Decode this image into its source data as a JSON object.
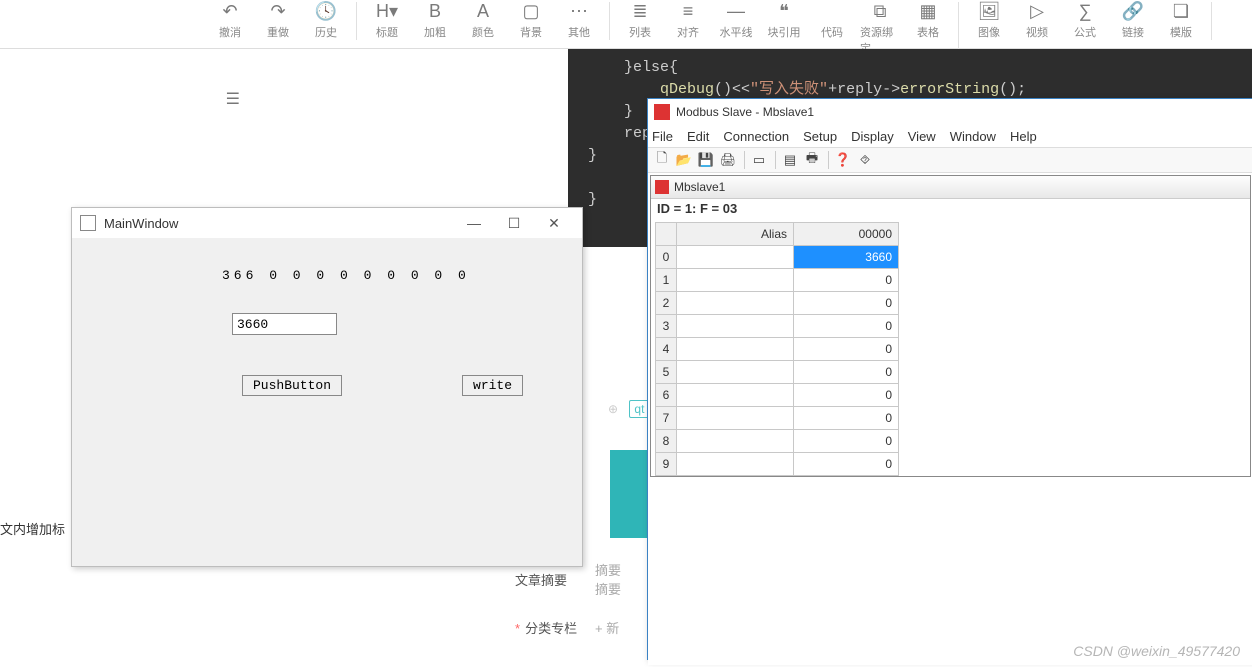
{
  "toolbar": {
    "groups": [
      [
        {
          "icon": "↶",
          "label": "撤消"
        },
        {
          "icon": "↷",
          "label": "重做"
        },
        {
          "icon": "🕓",
          "label": "历史"
        }
      ],
      [
        {
          "icon": "H▾",
          "label": "标题"
        },
        {
          "icon": "B",
          "label": "加粗"
        },
        {
          "icon": "A",
          "label": "颜色"
        },
        {
          "icon": "▢",
          "label": "背景"
        },
        {
          "icon": "⋯",
          "label": "其他"
        }
      ],
      [
        {
          "icon": "≣",
          "label": "列表"
        },
        {
          "icon": "≡",
          "label": "对齐"
        },
        {
          "icon": "―",
          "label": "水平线"
        },
        {
          "icon": "❝",
          "label": "块引用"
        },
        {
          "icon": "</> ",
          "label": "代码"
        },
        {
          "icon": "⧉",
          "label": "资源绑定"
        },
        {
          "icon": "▦",
          "label": "表格"
        }
      ],
      [
        {
          "icon": "🖼",
          "label": "图像"
        },
        {
          "icon": "▷",
          "label": "视频"
        },
        {
          "icon": "∑",
          "label": "公式"
        },
        {
          "icon": "🔗",
          "label": "链接"
        },
        {
          "icon": "❏",
          "label": "模版"
        }
      ]
    ]
  },
  "left_hint": "文内增加标",
  "code": {
    "l1": "}else{",
    "l2a": "qDebug",
    "l2b": "()<<",
    "l2c": "\"写入失败\"",
    "l2d": "+reply->",
    "l2e": "errorString",
    "l2f": "();",
    "l3": "}",
    "l4": "reply->",
    "l5": "}",
    "l6": "}"
  },
  "qt": {
    "title": "MainWindow",
    "controls": {
      "min": "—",
      "max": "☐",
      "close": "✕"
    },
    "array_text": "366 0 0 0 0 0 0 0 0 0",
    "input_value": "3660",
    "button1": "PushButton",
    "button2": "write"
  },
  "tag": {
    "label": "qt",
    "x": "×"
  },
  "form": {
    "row1_label": "文章摘要",
    "row1_ph1": "摘要",
    "row1_ph2": "摘要",
    "row2_label": "分类专栏",
    "row2_btn": "+ 新"
  },
  "modbus": {
    "title": "Modbus Slave - Mbslave1",
    "menu": [
      "File",
      "Edit",
      "Connection",
      "Setup",
      "Display",
      "View",
      "Window",
      "Help"
    ],
    "tools": [
      "🗋",
      "📂",
      "💾",
      "🖨",
      "|",
      "▭",
      "|",
      "▤",
      "🖶",
      "|",
      "❓",
      "⯑"
    ],
    "child_title": "Mbslave1",
    "info": "ID = 1: F = 03",
    "headers": {
      "alias": "Alias",
      "val": "00000"
    },
    "rows": [
      {
        "idx": "0",
        "alias": "",
        "val": "3660",
        "sel": true
      },
      {
        "idx": "1",
        "alias": "",
        "val": "0"
      },
      {
        "idx": "2",
        "alias": "",
        "val": "0"
      },
      {
        "idx": "3",
        "alias": "",
        "val": "0"
      },
      {
        "idx": "4",
        "alias": "",
        "val": "0"
      },
      {
        "idx": "5",
        "alias": "",
        "val": "0"
      },
      {
        "idx": "6",
        "alias": "",
        "val": "0"
      },
      {
        "idx": "7",
        "alias": "",
        "val": "0"
      },
      {
        "idx": "8",
        "alias": "",
        "val": "0"
      },
      {
        "idx": "9",
        "alias": "",
        "val": "0"
      }
    ]
  },
  "watermark": "CSDN @weixin_49577420"
}
